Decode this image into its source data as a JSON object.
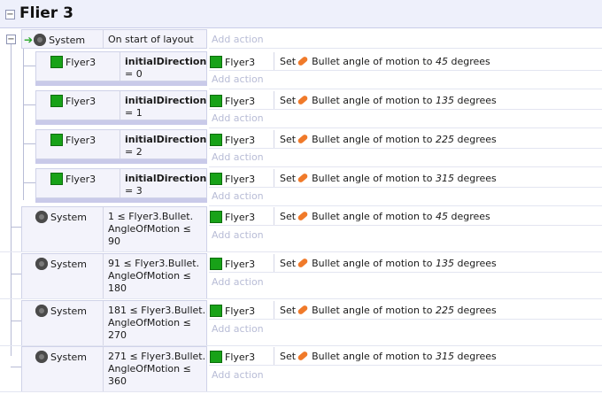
{
  "group_title": "Flier 3",
  "toggle_symbol": "−",
  "add_action_label": "Add action",
  "colors": {
    "accent_green": "#18a218",
    "bullet_orange": "#f07a2a",
    "header_bg": "#eef0fb"
  },
  "event_top": {
    "object": "System",
    "condition": "On start of layout"
  },
  "sub_events": [
    {
      "object": "Flyer3",
      "cond_name": "initialDirection",
      "cond_value": "= 0",
      "action": {
        "object": "Flyer3",
        "prefix": "Set",
        "text": "Bullet angle of motion to",
        "value": "45",
        "unit": "degrees"
      }
    },
    {
      "object": "Flyer3",
      "cond_name": "initialDirection",
      "cond_value": "= 1",
      "action": {
        "object": "Flyer3",
        "prefix": "Set",
        "text": "Bullet angle of motion to",
        "value": "135",
        "unit": "degrees"
      }
    },
    {
      "object": "Flyer3",
      "cond_name": "initialDirection",
      "cond_value": "= 2",
      "action": {
        "object": "Flyer3",
        "prefix": "Set",
        "text": "Bullet angle of motion to",
        "value": "225",
        "unit": "degrees"
      }
    },
    {
      "object": "Flyer3",
      "cond_name": "initialDirection",
      "cond_value": "= 3",
      "action": {
        "object": "Flyer3",
        "prefix": "Set",
        "text": "Bullet angle of motion to",
        "value": "315",
        "unit": "degrees"
      }
    }
  ],
  "range_events": [
    {
      "object": "System",
      "line1": "1 ≤ Flyer3.Bullet.",
      "line2": "AngleOfMotion ≤",
      "line3": "90",
      "action": {
        "object": "Flyer3",
        "prefix": "Set",
        "text": "Bullet angle of motion to",
        "value": "45",
        "unit": "degrees"
      }
    },
    {
      "object": "System",
      "line1": "91 ≤ Flyer3.Bullet.",
      "line2": "AngleOfMotion ≤",
      "line3": "180",
      "action": {
        "object": "Flyer3",
        "prefix": "Set",
        "text": "Bullet angle of motion to",
        "value": "135",
        "unit": "degrees"
      }
    },
    {
      "object": "System",
      "line1": "181 ≤ Flyer3.Bullet.",
      "line2": "AngleOfMotion ≤",
      "line3": "270",
      "action": {
        "object": "Flyer3",
        "prefix": "Set",
        "text": "Bullet angle of motion to",
        "value": "225",
        "unit": "degrees"
      }
    },
    {
      "object": "System",
      "line1": "271 ≤ Flyer3.Bullet.",
      "line2": "AngleOfMotion ≤",
      "line3": "360",
      "action": {
        "object": "Flyer3",
        "prefix": "Set",
        "text": "Bullet angle of motion to",
        "value": "315",
        "unit": "degrees"
      }
    }
  ]
}
